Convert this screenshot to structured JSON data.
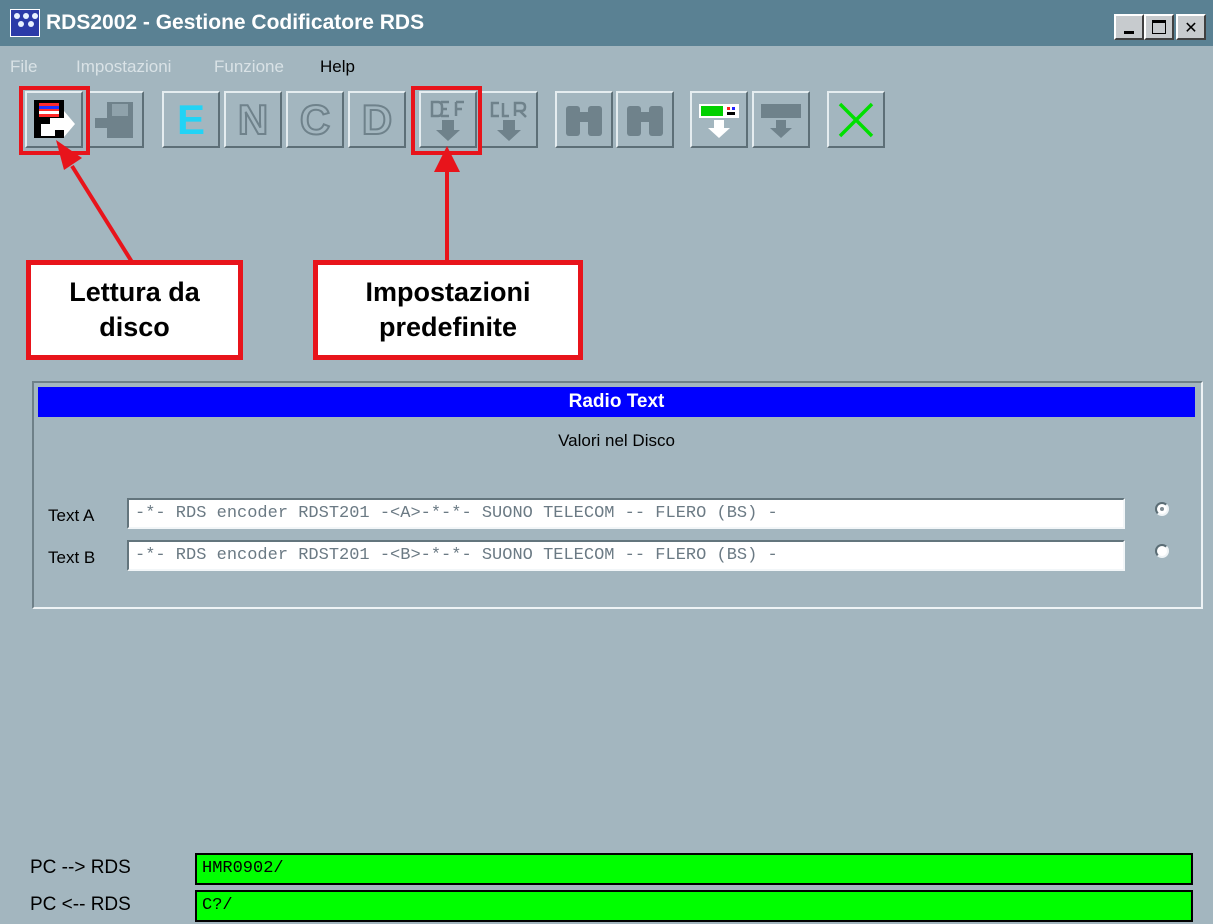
{
  "window": {
    "title": "RDS2002 - Gestione Codificatore RDS"
  },
  "menu": {
    "file": "File",
    "settings": "Impostazioni",
    "function": "Funzione",
    "help": "Help"
  },
  "toolbar": {
    "e": "E",
    "n": "N",
    "c": "C",
    "d": "D"
  },
  "callouts": {
    "read_disk": {
      "line1": "Lettura da",
      "line2": "disco"
    },
    "defaults": {
      "line1": "Impostazioni",
      "line2": "predefinite"
    }
  },
  "radio_text": {
    "header": "Radio Text",
    "subtitle": "Valori nel Disco",
    "text_a": {
      "label": "Text A",
      "value": "-*- RDS encoder RDST201 -<A>-*-*- SUONO TELECOM -- FLERO (BS) -"
    },
    "text_b": {
      "label": "Text B",
      "value": "-*- RDS encoder RDST201 -<B>-*-*- SUONO TELECOM -- FLERO (BS) -"
    }
  },
  "status": {
    "pc_to_rds": {
      "label": "PC --> RDS",
      "value": "HMR0902/"
    },
    "rds_to_pc": {
      "label": "PC <-- RDS",
      "value": "C?/"
    }
  },
  "colors": {
    "accent": "#e8141b",
    "header_blue": "#0000ff",
    "status_green": "#00ff00"
  }
}
